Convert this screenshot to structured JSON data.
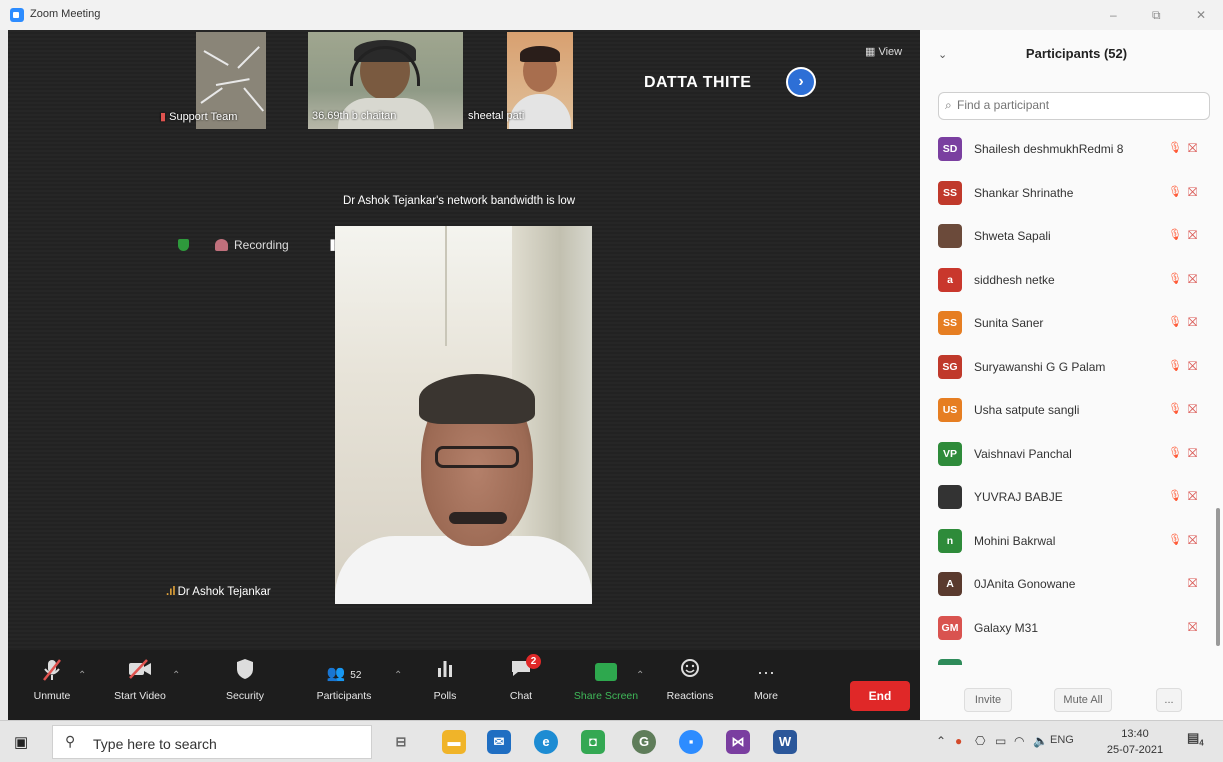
{
  "window": {
    "title": "Zoom Meeting",
    "controls": [
      "–",
      "⧉",
      "✕"
    ]
  },
  "meeting": {
    "view_label": "View",
    "active_speaker": "DATTA THITE",
    "next_label": "›",
    "gallery": [
      {
        "name": "Support Team"
      },
      {
        "name": "36.69th b chaitan"
      },
      {
        "name": "sheetal pati"
      }
    ],
    "bandwidth_notice": "Dr Ashok Tejankar's network bandwidth is low",
    "recording_label": "Recording",
    "main_participant": "Dr Ashok Tejankar"
  },
  "toolbar": {
    "unmute": "Unmute",
    "start_video": "Start Video",
    "security": "Security",
    "participants": "Participants",
    "participants_count": "52",
    "polls": "Polls",
    "chat": "Chat",
    "chat_badge": "2",
    "share_screen": "Share Screen",
    "reactions": "Reactions",
    "more": "More",
    "more_icon": "···",
    "end": "End"
  },
  "panel": {
    "title": "Participants (52)",
    "search_placeholder": "Find a participant",
    "participants": [
      {
        "initials": "SD",
        "name": "Shailesh deshmukhRedmi 8",
        "color": "#7a3fa0",
        "cam": true
      },
      {
        "initials": "SS",
        "name": "Shankar Shrinathe",
        "color": "#c0392b",
        "cam": true
      },
      {
        "initials": "",
        "name": "Shweta Sapali",
        "color": "#6b4a3a",
        "cam": true
      },
      {
        "initials": "a",
        "name": "siddhesh netke",
        "color": "#c9372c",
        "cam": true
      },
      {
        "initials": "SS",
        "name": "Sunita Saner",
        "color": "#e67e22",
        "cam": true
      },
      {
        "initials": "SG",
        "name": "Suryawanshi G G Palam",
        "color": "#c0392b",
        "cam": true
      },
      {
        "initials": "US",
        "name": "Usha satpute sangli",
        "color": "#e67e22",
        "cam": true
      },
      {
        "initials": "VP",
        "name": "Vaishnavi Panchal",
        "color": "#2e8b3a",
        "cam": true
      },
      {
        "initials": "",
        "name": "YUVRAJ BABJE",
        "color": "#333333",
        "cam": true
      },
      {
        "initials": "n",
        "name": "Mohini Bakrwal",
        "color": "#2e8b3a",
        "cam": true
      },
      {
        "initials": "A",
        "name": "0JAnita Gonowane",
        "color": "#5a3a2e",
        "cam": false
      },
      {
        "initials": "GM",
        "name": "Galaxy M31",
        "color": "#d9534f",
        "cam": false
      },
      {
        "initials": "",
        "name": "",
        "color": "#2e8b5a",
        "cam": false
      }
    ],
    "invite": "Invite",
    "mute_all": "Mute All",
    "more_foot": "..."
  },
  "taskbar": {
    "search_placeholder": "Type here to search",
    "language": "ENG",
    "time": "13:40",
    "date": "25-07-2021",
    "notif_count": "4"
  }
}
